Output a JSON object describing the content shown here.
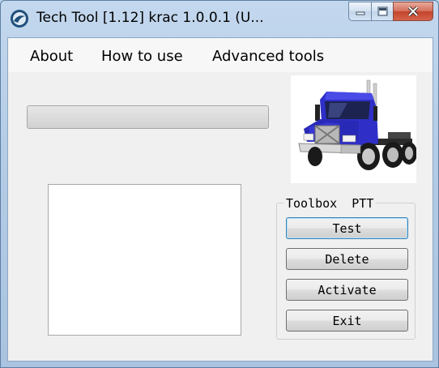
{
  "window": {
    "title": "Tech Tool [1.12]  krac 1.0.0.1   (U...",
    "minimize_icon": "minimize-icon",
    "maximize_icon": "maximize-icon",
    "close_icon": "close-icon"
  },
  "menu": {
    "items": [
      {
        "label": "About"
      },
      {
        "label": "How to use"
      },
      {
        "label": "Advanced tools"
      }
    ]
  },
  "progress": {
    "value": 0
  },
  "image": {
    "subject": "blue truck"
  },
  "toolbox": {
    "title": "Toolbox  PTT",
    "buttons": [
      {
        "label": "Test"
      },
      {
        "label": "Delete"
      },
      {
        "label": "Activate"
      },
      {
        "label": "Exit"
      }
    ]
  },
  "colors": {
    "truck_blue": "#2f2fc8",
    "close_red": "#c4442c"
  }
}
